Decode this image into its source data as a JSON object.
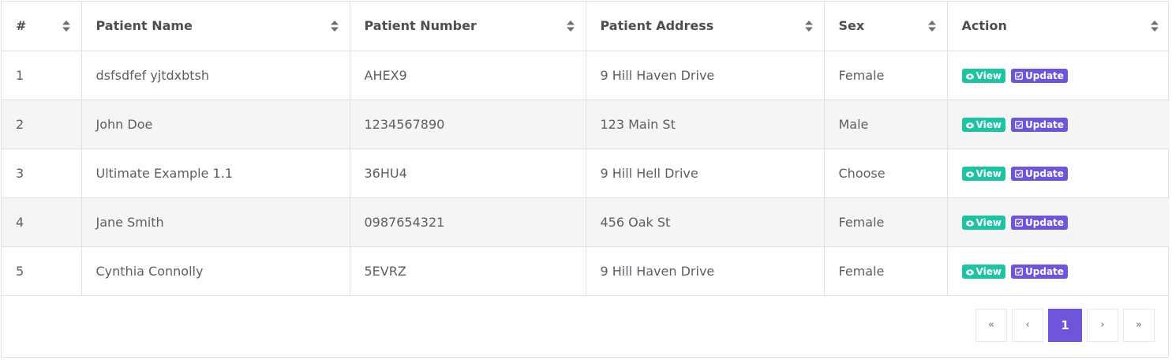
{
  "table": {
    "headers": [
      "#",
      "Patient Name",
      "Patient Number",
      "Patient Address",
      "Sex",
      "Action"
    ],
    "rows": [
      {
        "num": "1",
        "name": "dsfsdfef yjtdxbtsh",
        "number": "AHEX9",
        "address": "9 Hill Haven Drive",
        "sex": "Female"
      },
      {
        "num": "2",
        "name": "John Doe",
        "number": "1234567890",
        "address": "123 Main St",
        "sex": "Male"
      },
      {
        "num": "3",
        "name": "Ultimate Example 1.1",
        "number": "36HU4",
        "address": "9 Hill Hell Drive",
        "sex": "Choose"
      },
      {
        "num": "4",
        "name": "Jane Smith",
        "number": "0987654321",
        "address": "456 Oak St",
        "sex": "Female"
      },
      {
        "num": "5",
        "name": "Cynthia Connolly",
        "number": "5EVRZ",
        "address": "9 Hill Haven Drive",
        "sex": "Female"
      }
    ],
    "actions": {
      "view_label": "View",
      "update_label": "Update",
      "view_icon": "eye-icon",
      "update_icon": "checkbox-icon"
    }
  },
  "pagination": {
    "first": "«",
    "prev": "‹",
    "current": "1",
    "next": "›",
    "last": "»"
  },
  "colors": {
    "view": "#1ec3a4",
    "update": "#6f55d9",
    "active_page": "#6f55d9",
    "stripe": "#f5f5f5"
  }
}
